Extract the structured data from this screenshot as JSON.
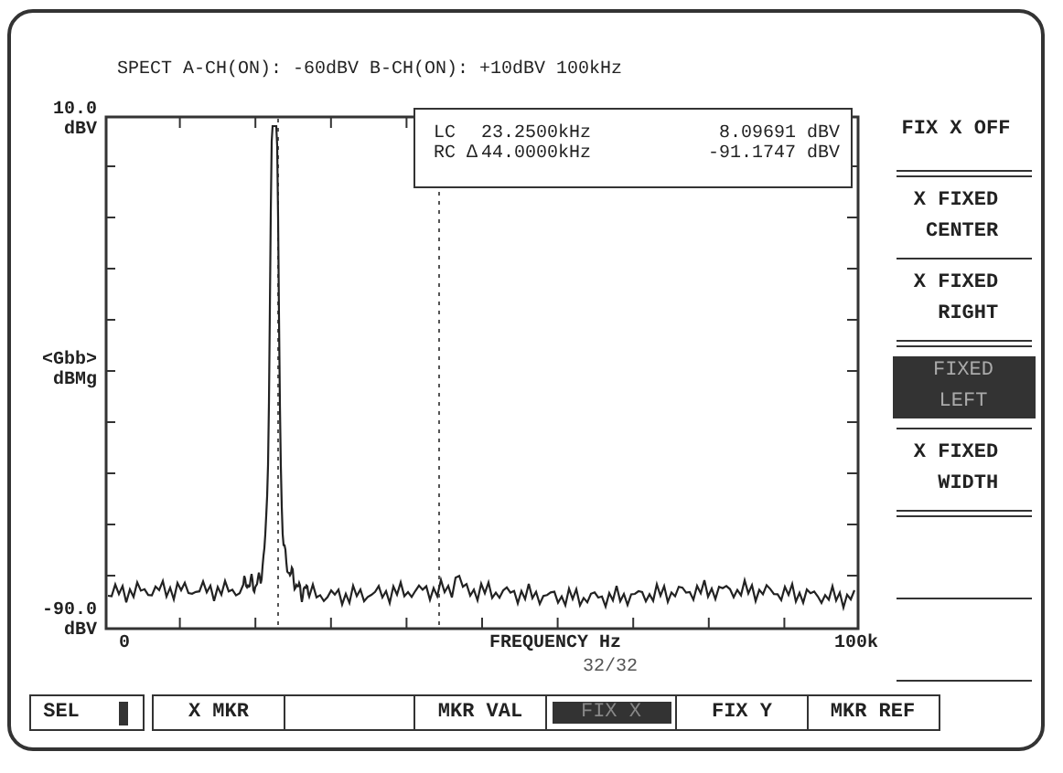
{
  "header": "SPECT A-CH(ON): -60dBV  B-CH(ON): +10dBV  100kHz",
  "y_axis": {
    "top": {
      "value": "10.0",
      "unit": "dBV"
    },
    "middle": {
      "value": "<Gbb>",
      "unit": "dBMg"
    },
    "bottom": {
      "value": "-90.0",
      "unit": "dBV"
    }
  },
  "x_axis": {
    "start": "0",
    "title": "FREQUENCY Hz",
    "end": "100k"
  },
  "markers": [
    {
      "label": "LC",
      "frequency": "23.2500kHz",
      "value": "8.09691 dBV"
    },
    {
      "label": "RC ∆",
      "frequency": "44.0000kHz",
      "value": "-91.1747 dBV"
    }
  ],
  "page_counter": "32/32",
  "side_menu": [
    {
      "label": "FIX X OFF",
      "selected": false
    },
    {
      "label": "X FIXED\nCENTER",
      "selected": false
    },
    {
      "label": "X FIXED\nRIGHT",
      "selected": false
    },
    {
      "label": "FIXED\nLEFT",
      "selected": true
    },
    {
      "label": "X FIXED\nWIDTH",
      "selected": false
    }
  ],
  "soft_keys": [
    {
      "kind": "select",
      "label": "SEL",
      "selected": false
    },
    {
      "kind": "key",
      "label": "X MKR",
      "selected": false
    },
    {
      "kind": "key",
      "selected": false
    },
    {
      "kind": "key",
      "label": "MKR VAL",
      "selected": false
    },
    {
      "kind": "key",
      "label": "FIX X",
      "selected": true
    },
    {
      "kind": "key",
      "label": "FIX Y",
      "selected": false
    },
    {
      "kind": "key",
      "label": "MKR REF",
      "selected": false
    }
  ]
}
